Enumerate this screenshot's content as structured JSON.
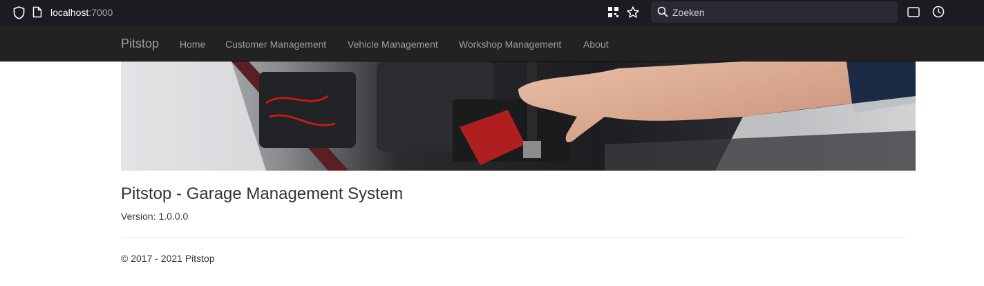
{
  "browser": {
    "url_host": "localhost",
    "url_port": ":7000",
    "search_placeholder": "Zoeken"
  },
  "navbar": {
    "brand": "Pitstop",
    "items": [
      {
        "label": "Home"
      },
      {
        "label": "Customer Management"
      },
      {
        "label": "Vehicle Management"
      },
      {
        "label": "Workshop Management"
      },
      {
        "label": "About"
      }
    ]
  },
  "main": {
    "title": "Pitstop - Garage Management System",
    "version": "Version: 1.0.0.0"
  },
  "footer": {
    "copyright": "© 2017 - 2021 Pitstop"
  },
  "colors": {
    "navbar_bg": "#222222",
    "nav_text": "#9d9d9d",
    "browser_bg": "#1c1b22"
  }
}
